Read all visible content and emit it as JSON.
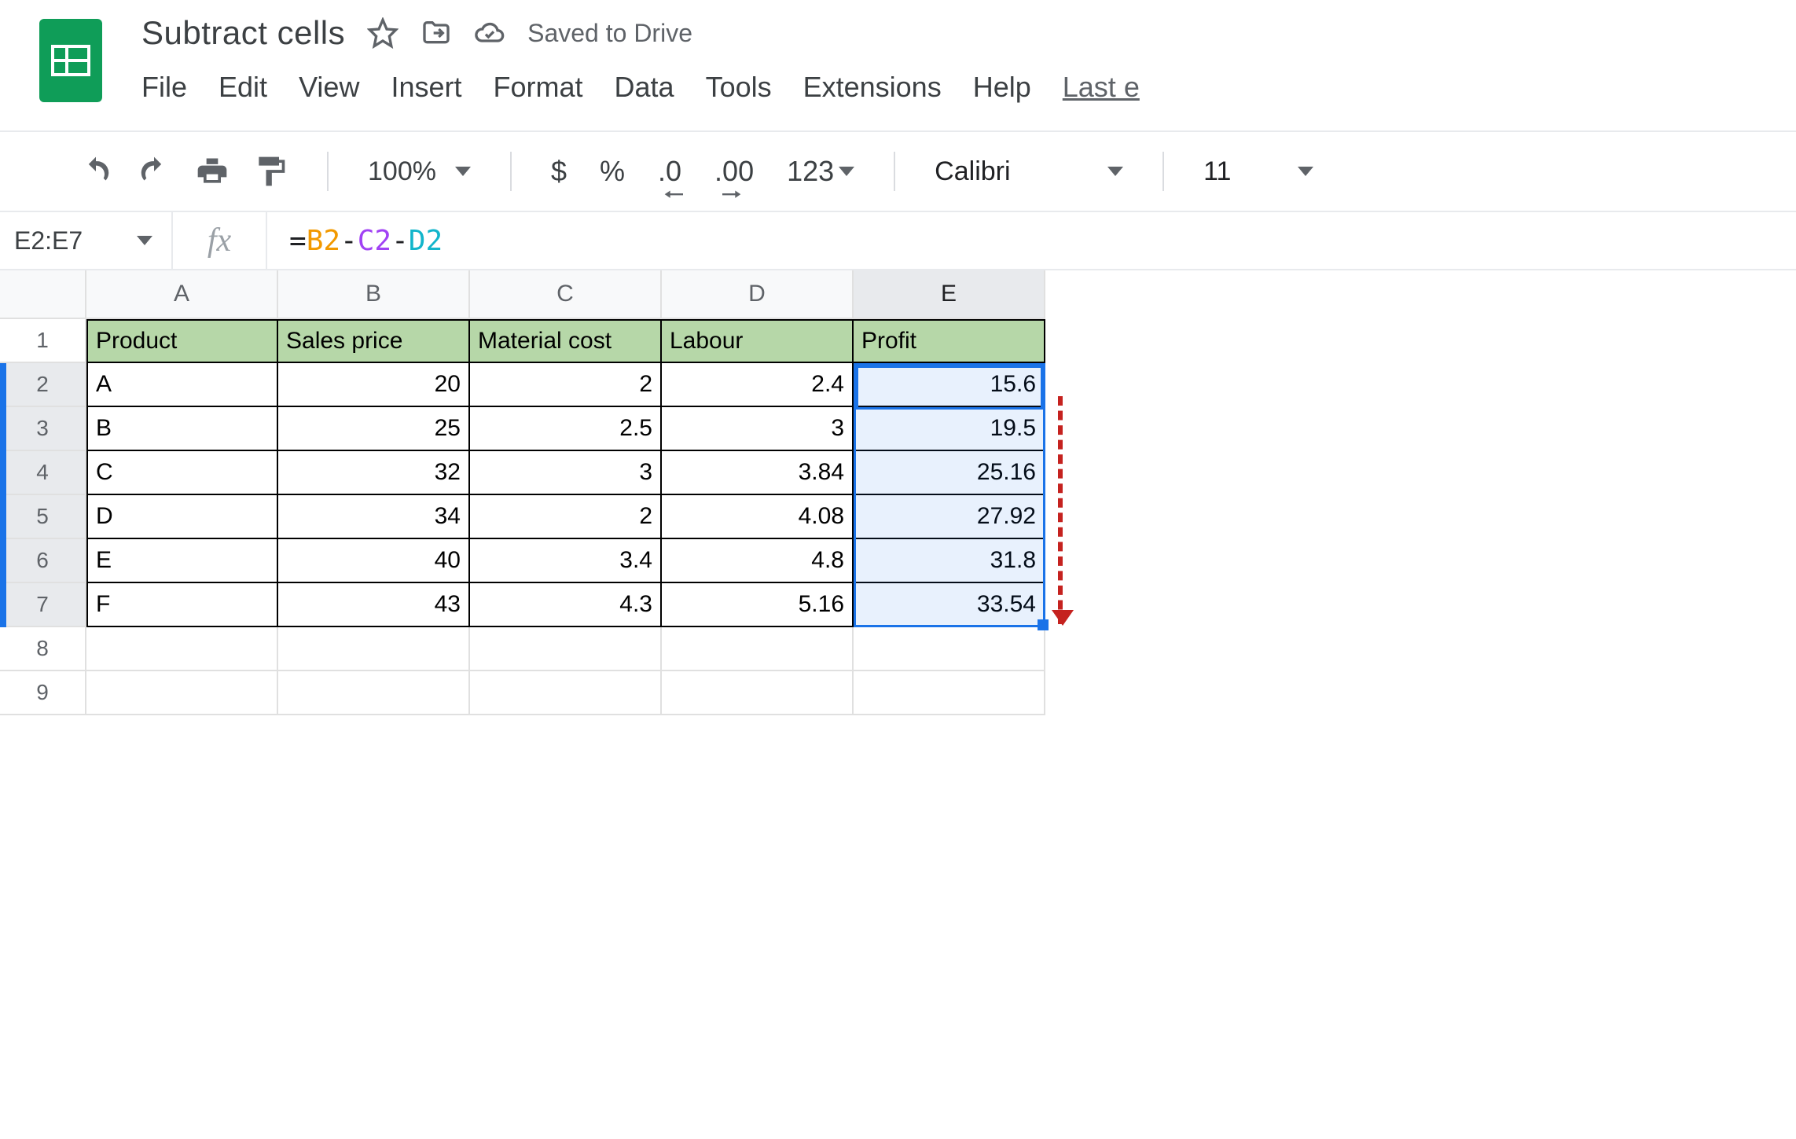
{
  "doc": {
    "title": "Subtract cells",
    "saved_text": "Saved to Drive"
  },
  "menus": {
    "file": "File",
    "edit": "Edit",
    "view": "View",
    "insert": "Insert",
    "format": "Format",
    "data": "Data",
    "tools": "Tools",
    "extensions": "Extensions",
    "help": "Help",
    "last_edit": "Last e"
  },
  "toolbar": {
    "zoom": "100%",
    "currency": "$",
    "percent": "%",
    "dec_dec": ".0",
    "inc_dec": ".00",
    "more_fmt": "123",
    "font_name": "Calibri",
    "font_size": "11"
  },
  "formula_bar": {
    "name_box": "E2:E7",
    "formula_eq": "=",
    "formula_b2": "B2",
    "formula_op": "-",
    "formula_c2": "C2",
    "formula_d2": "D2"
  },
  "columns": {
    "A": "A",
    "B": "B",
    "C": "C",
    "D": "D",
    "E": "E"
  },
  "row_numbers": [
    "1",
    "2",
    "3",
    "4",
    "5",
    "6",
    "7",
    "8",
    "9"
  ],
  "headers": {
    "product": "Product",
    "sales": "Sales price",
    "material": "Material cost",
    "labour": "Labour",
    "profit": "Profit"
  },
  "data": [
    {
      "product": "A",
      "sales": "20",
      "material": "2",
      "labour": "2.4",
      "profit": "15.6"
    },
    {
      "product": "B",
      "sales": "25",
      "material": "2.5",
      "labour": "3",
      "profit": "19.5"
    },
    {
      "product": "C",
      "sales": "32",
      "material": "3",
      "labour": "3.84",
      "profit": "25.16"
    },
    {
      "product": "D",
      "sales": "34",
      "material": "2",
      "labour": "4.08",
      "profit": "27.92"
    },
    {
      "product": "E",
      "sales": "40",
      "material": "3.4",
      "labour": "4.8",
      "profit": "31.8"
    },
    {
      "product": "F",
      "sales": "43",
      "material": "4.3",
      "labour": "5.16",
      "profit": "33.54"
    }
  ],
  "chart_data": {
    "type": "table",
    "title": "Subtract cells",
    "columns": [
      "Product",
      "Sales price",
      "Material cost",
      "Labour",
      "Profit"
    ],
    "rows": [
      [
        "A",
        20,
        2,
        2.4,
        15.6
      ],
      [
        "B",
        25,
        2.5,
        3,
        19.5
      ],
      [
        "C",
        32,
        3,
        3.84,
        25.16
      ],
      [
        "D",
        34,
        2,
        4.08,
        27.92
      ],
      [
        "E",
        40,
        3.4,
        4.8,
        31.8
      ],
      [
        "F",
        43,
        4.3,
        5.16,
        33.54
      ]
    ],
    "formula": "=B2-C2-D2",
    "selection": "E2:E7"
  }
}
